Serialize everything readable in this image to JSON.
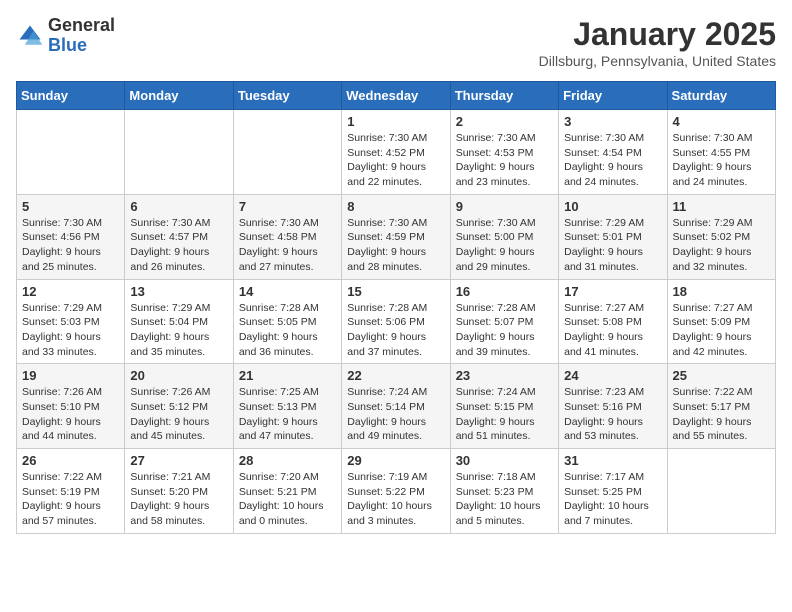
{
  "header": {
    "logo_general": "General",
    "logo_blue": "Blue",
    "month_title": "January 2025",
    "location": "Dillsburg, Pennsylvania, United States"
  },
  "days_of_week": [
    "Sunday",
    "Monday",
    "Tuesday",
    "Wednesday",
    "Thursday",
    "Friday",
    "Saturday"
  ],
  "weeks": [
    [
      {
        "day": "",
        "info": ""
      },
      {
        "day": "",
        "info": ""
      },
      {
        "day": "",
        "info": ""
      },
      {
        "day": "1",
        "info": "Sunrise: 7:30 AM\nSunset: 4:52 PM\nDaylight: 9 hours\nand 22 minutes."
      },
      {
        "day": "2",
        "info": "Sunrise: 7:30 AM\nSunset: 4:53 PM\nDaylight: 9 hours\nand 23 minutes."
      },
      {
        "day": "3",
        "info": "Sunrise: 7:30 AM\nSunset: 4:54 PM\nDaylight: 9 hours\nand 24 minutes."
      },
      {
        "day": "4",
        "info": "Sunrise: 7:30 AM\nSunset: 4:55 PM\nDaylight: 9 hours\nand 24 minutes."
      }
    ],
    [
      {
        "day": "5",
        "info": "Sunrise: 7:30 AM\nSunset: 4:56 PM\nDaylight: 9 hours\nand 25 minutes."
      },
      {
        "day": "6",
        "info": "Sunrise: 7:30 AM\nSunset: 4:57 PM\nDaylight: 9 hours\nand 26 minutes."
      },
      {
        "day": "7",
        "info": "Sunrise: 7:30 AM\nSunset: 4:58 PM\nDaylight: 9 hours\nand 27 minutes."
      },
      {
        "day": "8",
        "info": "Sunrise: 7:30 AM\nSunset: 4:59 PM\nDaylight: 9 hours\nand 28 minutes."
      },
      {
        "day": "9",
        "info": "Sunrise: 7:30 AM\nSunset: 5:00 PM\nDaylight: 9 hours\nand 29 minutes."
      },
      {
        "day": "10",
        "info": "Sunrise: 7:29 AM\nSunset: 5:01 PM\nDaylight: 9 hours\nand 31 minutes."
      },
      {
        "day": "11",
        "info": "Sunrise: 7:29 AM\nSunset: 5:02 PM\nDaylight: 9 hours\nand 32 minutes."
      }
    ],
    [
      {
        "day": "12",
        "info": "Sunrise: 7:29 AM\nSunset: 5:03 PM\nDaylight: 9 hours\nand 33 minutes."
      },
      {
        "day": "13",
        "info": "Sunrise: 7:29 AM\nSunset: 5:04 PM\nDaylight: 9 hours\nand 35 minutes."
      },
      {
        "day": "14",
        "info": "Sunrise: 7:28 AM\nSunset: 5:05 PM\nDaylight: 9 hours\nand 36 minutes."
      },
      {
        "day": "15",
        "info": "Sunrise: 7:28 AM\nSunset: 5:06 PM\nDaylight: 9 hours\nand 37 minutes."
      },
      {
        "day": "16",
        "info": "Sunrise: 7:28 AM\nSunset: 5:07 PM\nDaylight: 9 hours\nand 39 minutes."
      },
      {
        "day": "17",
        "info": "Sunrise: 7:27 AM\nSunset: 5:08 PM\nDaylight: 9 hours\nand 41 minutes."
      },
      {
        "day": "18",
        "info": "Sunrise: 7:27 AM\nSunset: 5:09 PM\nDaylight: 9 hours\nand 42 minutes."
      }
    ],
    [
      {
        "day": "19",
        "info": "Sunrise: 7:26 AM\nSunset: 5:10 PM\nDaylight: 9 hours\nand 44 minutes."
      },
      {
        "day": "20",
        "info": "Sunrise: 7:26 AM\nSunset: 5:12 PM\nDaylight: 9 hours\nand 45 minutes."
      },
      {
        "day": "21",
        "info": "Sunrise: 7:25 AM\nSunset: 5:13 PM\nDaylight: 9 hours\nand 47 minutes."
      },
      {
        "day": "22",
        "info": "Sunrise: 7:24 AM\nSunset: 5:14 PM\nDaylight: 9 hours\nand 49 minutes."
      },
      {
        "day": "23",
        "info": "Sunrise: 7:24 AM\nSunset: 5:15 PM\nDaylight: 9 hours\nand 51 minutes."
      },
      {
        "day": "24",
        "info": "Sunrise: 7:23 AM\nSunset: 5:16 PM\nDaylight: 9 hours\nand 53 minutes."
      },
      {
        "day": "25",
        "info": "Sunrise: 7:22 AM\nSunset: 5:17 PM\nDaylight: 9 hours\nand 55 minutes."
      }
    ],
    [
      {
        "day": "26",
        "info": "Sunrise: 7:22 AM\nSunset: 5:19 PM\nDaylight: 9 hours\nand 57 minutes."
      },
      {
        "day": "27",
        "info": "Sunrise: 7:21 AM\nSunset: 5:20 PM\nDaylight: 9 hours\nand 58 minutes."
      },
      {
        "day": "28",
        "info": "Sunrise: 7:20 AM\nSunset: 5:21 PM\nDaylight: 10 hours\nand 0 minutes."
      },
      {
        "day": "29",
        "info": "Sunrise: 7:19 AM\nSunset: 5:22 PM\nDaylight: 10 hours\nand 3 minutes."
      },
      {
        "day": "30",
        "info": "Sunrise: 7:18 AM\nSunset: 5:23 PM\nDaylight: 10 hours\nand 5 minutes."
      },
      {
        "day": "31",
        "info": "Sunrise: 7:17 AM\nSunset: 5:25 PM\nDaylight: 10 hours\nand 7 minutes."
      },
      {
        "day": "",
        "info": ""
      }
    ]
  ]
}
